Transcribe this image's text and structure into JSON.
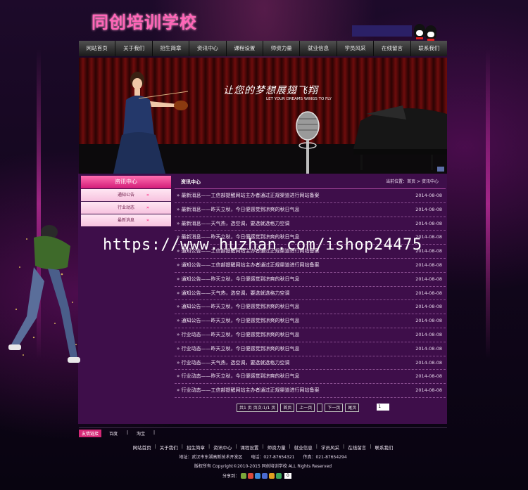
{
  "header": {
    "logo_text": "同创培训学校",
    "colors": {
      "logo": "#ff66b8",
      "accent": "#d21c78",
      "panel": "#3e0e4a"
    }
  },
  "nav": {
    "items": [
      "网站首页",
      "关于我们",
      "招生简章",
      "资讯中心",
      "课程设置",
      "师资力量",
      "就业信息",
      "学员风采",
      "在线留言",
      "联系我们"
    ]
  },
  "banner": {
    "slogan": "让您的梦想展翅飞翔",
    "slogan_en": "LET YOUR DREAMS WINGS TO FLY"
  },
  "sidebar": {
    "title": "资讯中心",
    "items": [
      {
        "label": "通知公告",
        "arrow": "»"
      },
      {
        "label": "行业动态",
        "arrow": "»"
      },
      {
        "label": "最新消息",
        "arrow": "»"
      }
    ]
  },
  "content": {
    "title": "资讯中心",
    "breadcrumb": "当前位置：首页 > 资讯中心",
    "rows": [
      {
        "title": "» 最新消息——工信部提醒网站主办者通过正规渠道进行网站备案",
        "date": "2014-08-08"
      },
      {
        "title": "» 最新消息——昨天立秋，今日便感觉到凉爽的秋日气息",
        "date": "2014-08-08"
      },
      {
        "title": "» 最新消息——天气热，选空调，要选就选格力空调",
        "date": "2014-08-08"
      },
      {
        "title": "» 最新消息——昨天立秋，今日便感觉到凉爽的秋日气息",
        "date": "2014-08-08"
      },
      {
        "title": "» 通知公告——工信部提醒网站主办者通过正规渠道进行网站备案",
        "date": "2014-08-08"
      },
      {
        "title": "» 通知公告——工信部提醒网站主办者通过正规渠道进行网站备案",
        "date": "2014-08-08"
      },
      {
        "title": "» 通知公告——昨天立秋，今日便感觉到凉爽的秋日气息",
        "date": "2014-08-08"
      },
      {
        "title": "» 通知公告——天气热，选空调，要选就选格力空调",
        "date": "2014-08-08"
      },
      {
        "title": "» 通知公告——昨天立秋，今日便感觉到凉爽的秋日气息",
        "date": "2014-08-08"
      },
      {
        "title": "» 通知公告——昨天立秋，今日便感觉到凉爽的秋日气息",
        "date": "2014-08-08"
      },
      {
        "title": "» 行业动态——昨天立秋，今日便感觉到凉爽的秋日气息",
        "date": "2014-08-08"
      },
      {
        "title": "» 行业动态——昨天立秋，今日便感觉到凉爽的秋日气息",
        "date": "2014-08-08"
      },
      {
        "title": "» 行业动态——天气热，选空调，要选就选格力空调",
        "date": "2014-08-08"
      },
      {
        "title": "» 行业动态——昨天立秋，今日便感觉到凉爽的秋日气息",
        "date": "2014-08-08"
      },
      {
        "title": "» 行业动态——工信部提醒网站主办者通过正规渠道进行网站备案",
        "date": "2014-08-08"
      }
    ],
    "pager": {
      "info": "共1 页 页次:1/1 页",
      "first": "首页",
      "prev": "上一页",
      "blank": "",
      "next": "下一页",
      "last": "尾页",
      "select_value": "1"
    }
  },
  "watermark": "https://www.huzhan.com/ishop24475",
  "links": {
    "label": "友情链接",
    "items": [
      "百度",
      "淘宝"
    ],
    "sep": "|"
  },
  "footer": {
    "nav": [
      "网站首页",
      "关于我们",
      "招生简章",
      "资讯中心",
      "课程设置",
      "师资力量",
      "就业信息",
      "学员风采",
      "在线留言",
      "联系我们"
    ],
    "sep": "|",
    "address": "地址：武汉市东湖高新技术开发区　　电话：027-87654321　　传真：021-87654294",
    "copyright": "版权所有 Copyright©2010-2015 同创培训学校 ALL Rights Reserved",
    "share_label": "分享到：",
    "share_count": "0"
  }
}
